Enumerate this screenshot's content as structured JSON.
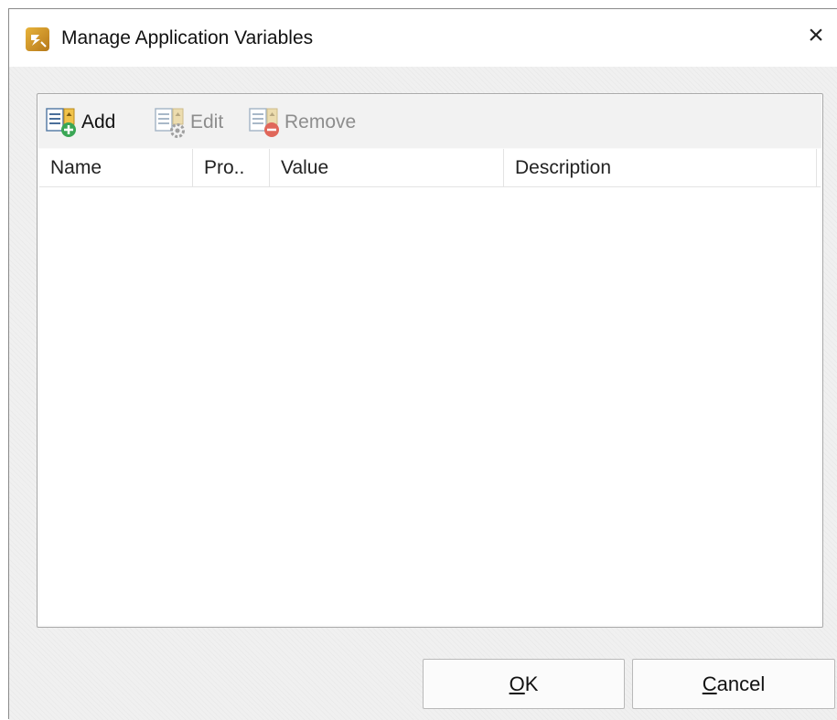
{
  "window": {
    "title": "Manage Application Variables",
    "close_glyph": "×",
    "app_icon": "pdf-editor-app-icon"
  },
  "toolbar": {
    "add": {
      "label": "Add",
      "icon": "add-variable-icon",
      "enabled": true
    },
    "edit": {
      "label": "Edit",
      "icon": "edit-variable-icon",
      "enabled": false
    },
    "remove": {
      "label": "Remove",
      "icon": "remove-variable-icon",
      "enabled": false
    }
  },
  "list": {
    "columns": [
      "Name",
      "Pro..",
      "Value",
      "Description"
    ],
    "rows": []
  },
  "buttons": {
    "ok": {
      "accel": "O",
      "rest": "K"
    },
    "cancel": {
      "accel": "C",
      "rest": "ancel"
    }
  },
  "colors": {
    "window_bg": "#f0f0f0",
    "list_bg": "#ffffff",
    "add_green": "#3aa655",
    "remove_red": "#e0675a",
    "icon_gold": "#d9a43a"
  }
}
